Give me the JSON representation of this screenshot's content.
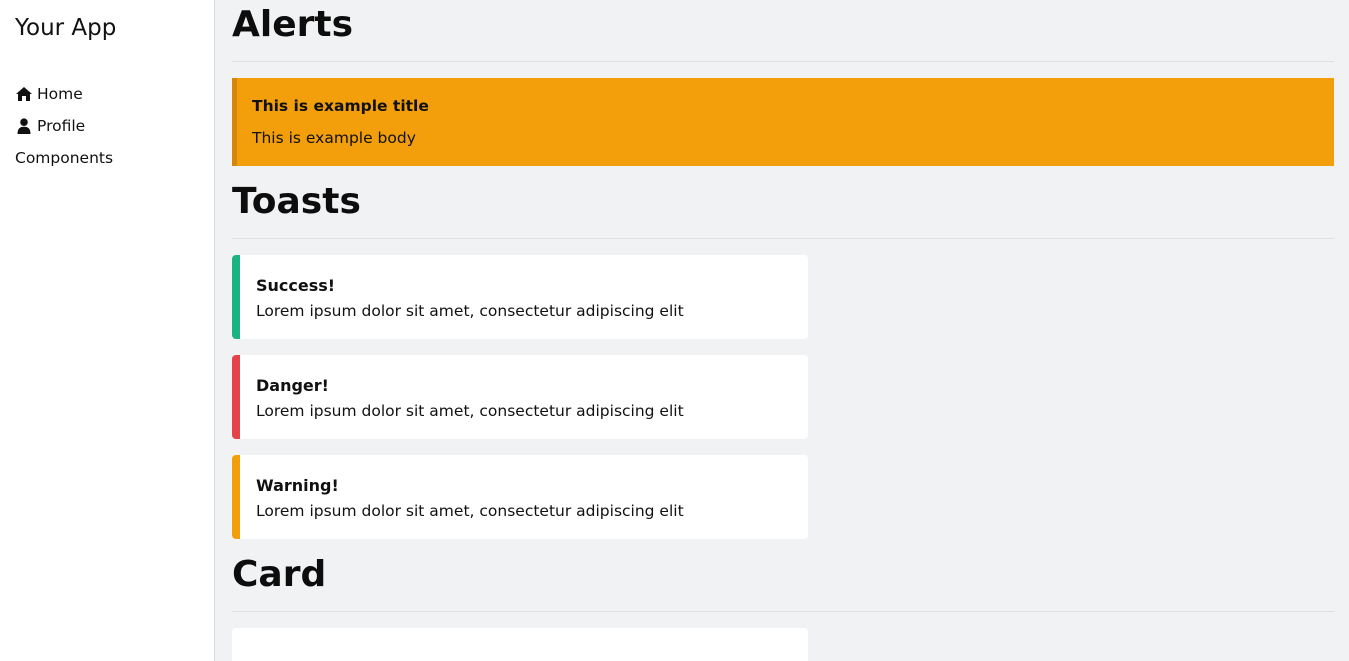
{
  "sidebar": {
    "app_title": "Your App",
    "items": [
      {
        "label": "Home",
        "icon": "home-icon"
      },
      {
        "label": "Profile",
        "icon": "user-icon"
      },
      {
        "label": "Components",
        "icon": ""
      }
    ]
  },
  "sections": {
    "alerts": {
      "heading": "Alerts"
    },
    "toasts": {
      "heading": "Toasts"
    },
    "card": {
      "heading": "Card"
    }
  },
  "alert": {
    "title": "This is example title",
    "body": "This is example body",
    "color": "#f39f0c"
  },
  "toasts": [
    {
      "title": "Success!",
      "body": "Lorem ipsum dolor sit amet, consectetur adipiscing elit",
      "color": "#1bb382"
    },
    {
      "title": "Danger!",
      "body": "Lorem ipsum dolor sit amet, consectetur adipiscing elit",
      "color": "#e5424a"
    },
    {
      "title": "Warning!",
      "body": "Lorem ipsum dolor sit amet, consectetur adipiscing elit",
      "color": "#f39f0c"
    }
  ]
}
